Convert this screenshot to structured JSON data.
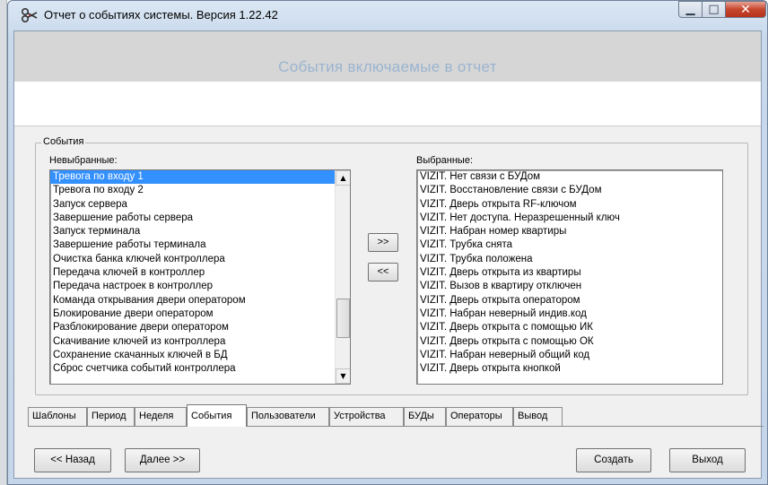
{
  "window": {
    "title": "Отчет о событиях системы.  Версия 1.22.42",
    "app_icon": "scissors-icon",
    "controls": {
      "minimize": "minimize-icon",
      "maximize": "maximize-icon",
      "close": "close-icon"
    }
  },
  "header": {
    "title": "События включаемые в отчет"
  },
  "events_group": {
    "legend": "События",
    "unselected_label": "Невыбранные:",
    "selected_label": "Выбранные:",
    "unselected": [
      "Тревога по входу 1",
      "Тревога по входу 2",
      "Запуск сервера",
      "Завершение работы сервера",
      "Запуск терминала",
      "Завершение работы терминала",
      "Очистка банка ключей контроллера",
      "Передача ключей в контроллер",
      "Передача настроек в контроллер",
      "Команда открывания двери оператором",
      "Блокирование двери оператором",
      "Разблокирование двери оператором",
      "Скачивание ключей из контроллера",
      "Сохранение скачанных ключей в БД",
      "Сброс счетчика событий контроллера"
    ],
    "selected_index": 0,
    "selected": [
      "VIZIT. Нет связи с БУДом",
      "VIZIT. Восстановление связи с БУДом",
      "VIZIT. Дверь открыта RF-ключом",
      "VIZIT. Нет доступа. Неразрешенный ключ",
      "VIZIT. Набран номер квартиры",
      "VIZIT. Трубка снята",
      "VIZIT. Трубка положена",
      "VIZIT. Дверь открыта из квартиры",
      "VIZIT. Вызов в квартиру отключен",
      "VIZIT. Дверь открыта оператором",
      "VIZIT. Набран неверный индив.код",
      "VIZIT. Дверь открыта с помощью ИК",
      "VIZIT. Дверь открыта с помощью ОК",
      "VIZIT. Набран неверный общий код",
      "VIZIT. Дверь открыта кнопкой"
    ],
    "add_button": ">>",
    "remove_button": "<<",
    "scroll_up_icon": "arrow-up-icon",
    "scroll_down_icon": "arrow-down-icon"
  },
  "tabs": [
    "Шаблоны",
    "Период",
    "Неделя",
    "События",
    "Пользователи",
    "Устройства",
    "БУДы",
    "Операторы",
    "Вывод"
  ],
  "active_tab": "События",
  "buttons": {
    "back": "<< Назад",
    "next": "Далее >>",
    "create": "Создать",
    "exit": "Выход"
  }
}
